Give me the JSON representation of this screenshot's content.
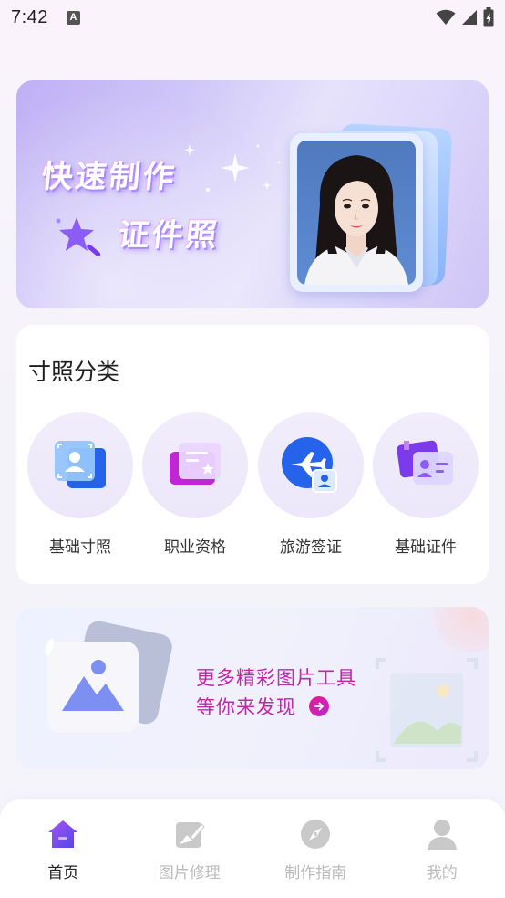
{
  "status_bar": {
    "time": "7:42",
    "notification_icon": "a-notification-icon",
    "icons": [
      "wifi-icon",
      "signal-icon",
      "battery-icon"
    ]
  },
  "banner": {
    "title_line1": "快速制作",
    "title_line2": "证件照",
    "image": "id-photo-portrait"
  },
  "category": {
    "title": "寸照分类",
    "items": [
      {
        "label": "基础寸照",
        "icon": "portrait-card-icon"
      },
      {
        "label": "职业资格",
        "icon": "certificate-card-icon"
      },
      {
        "label": "旅游签证",
        "icon": "airplane-icon"
      },
      {
        "label": "基础证件",
        "icon": "id-card-icon"
      }
    ]
  },
  "promo": {
    "line1": "更多精彩图片工具",
    "line2": "等你来发现",
    "icon": "image-tool-icon"
  },
  "tabbar": {
    "tabs": [
      {
        "label": "首页",
        "icon": "home-icon",
        "active": true
      },
      {
        "label": "图片修理",
        "icon": "image-edit-icon",
        "active": false
      },
      {
        "label": "制作指南",
        "icon": "compass-icon",
        "active": false
      },
      {
        "label": "我的",
        "icon": "user-icon",
        "active": false
      }
    ]
  },
  "colors": {
    "accent": "#7c5cf0",
    "promo_text": "#c026a6",
    "tab_active": "#222222",
    "tab_inactive": "#bbbbbb"
  }
}
